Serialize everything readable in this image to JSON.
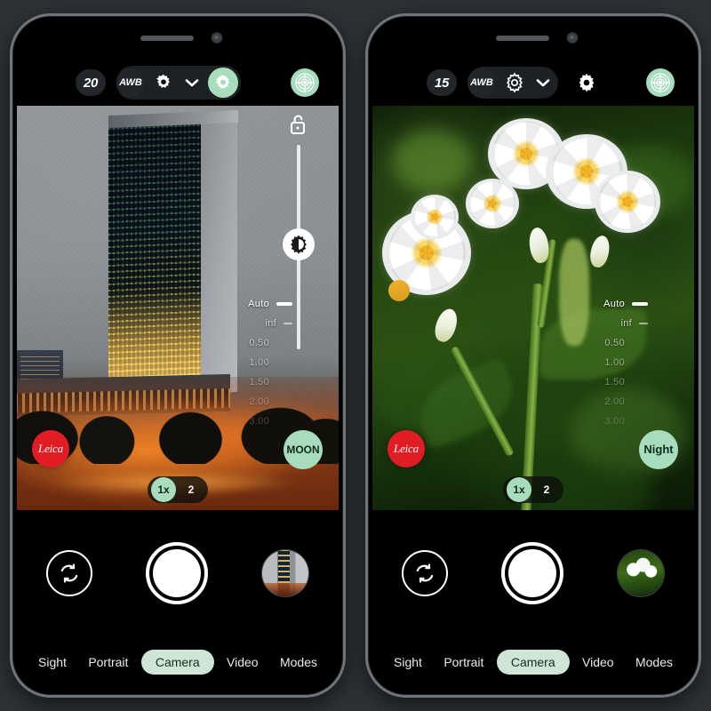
{
  "background_color": "#2d3237",
  "accent_color": "#a7dcbd",
  "leica_red": "#e01d24",
  "phones": [
    {
      "id": "phone-left",
      "topbar": {
        "counter": "20",
        "white_balance": "AWB",
        "gear_icon": "gear-icon",
        "chevron_icon": "chevron-down-icon",
        "shutter_mode_icon": "aperture-icon",
        "secondary_gear_icon": "gear-icon",
        "top_right_icon": "aperture-capture-icon",
        "shutter_chip_active": true,
        "plain_gear_visible": false
      },
      "viewfinder": {
        "scene": "night-city-skyscraper",
        "lock_icon": "unlocked-padlock-icon",
        "exposure_icon": "brightness-icon",
        "focus_scale": [
          {
            "label": "Auto",
            "state": "active"
          },
          {
            "label": "inf",
            "state": "semi"
          },
          {
            "label": "0.50",
            "state": "dim"
          },
          {
            "label": "1.00",
            "state": "dim"
          },
          {
            "label": "1.50",
            "state": "dim"
          },
          {
            "label": "2.00",
            "state": "dim"
          },
          {
            "label": "3.00",
            "state": "dim"
          }
        ],
        "leica_badge": "Leica",
        "mode_badge": "MOON",
        "zoom_options": [
          {
            "label": "1x",
            "active": true
          },
          {
            "label": "2",
            "active": false
          }
        ]
      },
      "controls": {
        "switch_camera_icon": "camera-switch-icon",
        "shutter_icon": "shutter-button",
        "thumbnail": "last-photo-city-thumbnail"
      },
      "mode_tabs": [
        {
          "label": "Sight",
          "active": false
        },
        {
          "label": "Portrait",
          "active": false
        },
        {
          "label": "Camera",
          "active": true
        },
        {
          "label": "Video",
          "active": false
        },
        {
          "label": "Modes",
          "active": false
        }
      ]
    },
    {
      "id": "phone-right",
      "topbar": {
        "counter": "15",
        "white_balance": "AWB",
        "gear_icon": "gear-icon",
        "chevron_icon": "chevron-down-icon",
        "shutter_mode_icon": "aperture-icon",
        "secondary_gear_icon": "gear-icon",
        "top_right_icon": "aperture-capture-icon",
        "shutter_chip_active": false,
        "plain_gear_visible": true
      },
      "viewfinder": {
        "scene": "white-potato-flowers",
        "lock_icon": "unlocked-padlock-icon",
        "exposure_icon": "brightness-icon",
        "focus_scale": [
          {
            "label": "Auto",
            "state": "active"
          },
          {
            "label": "inf",
            "state": "semi"
          },
          {
            "label": "0.50",
            "state": "dim"
          },
          {
            "label": "1.00",
            "state": "dim"
          },
          {
            "label": "1.50",
            "state": "dim"
          },
          {
            "label": "2.00",
            "state": "dim"
          },
          {
            "label": "3.00",
            "state": "dim"
          }
        ],
        "leica_badge": "Leica",
        "mode_badge": "Night",
        "zoom_options": [
          {
            "label": "1x",
            "active": true
          },
          {
            "label": "2",
            "active": false
          }
        ]
      },
      "controls": {
        "switch_camera_icon": "camera-switch-icon",
        "shutter_icon": "shutter-button",
        "thumbnail": "last-photo-flower-thumbnail"
      },
      "mode_tabs": [
        {
          "label": "Sight",
          "active": false
        },
        {
          "label": "Portrait",
          "active": false
        },
        {
          "label": "Camera",
          "active": true
        },
        {
          "label": "Video",
          "active": false
        },
        {
          "label": "Modes",
          "active": false
        }
      ]
    }
  ]
}
